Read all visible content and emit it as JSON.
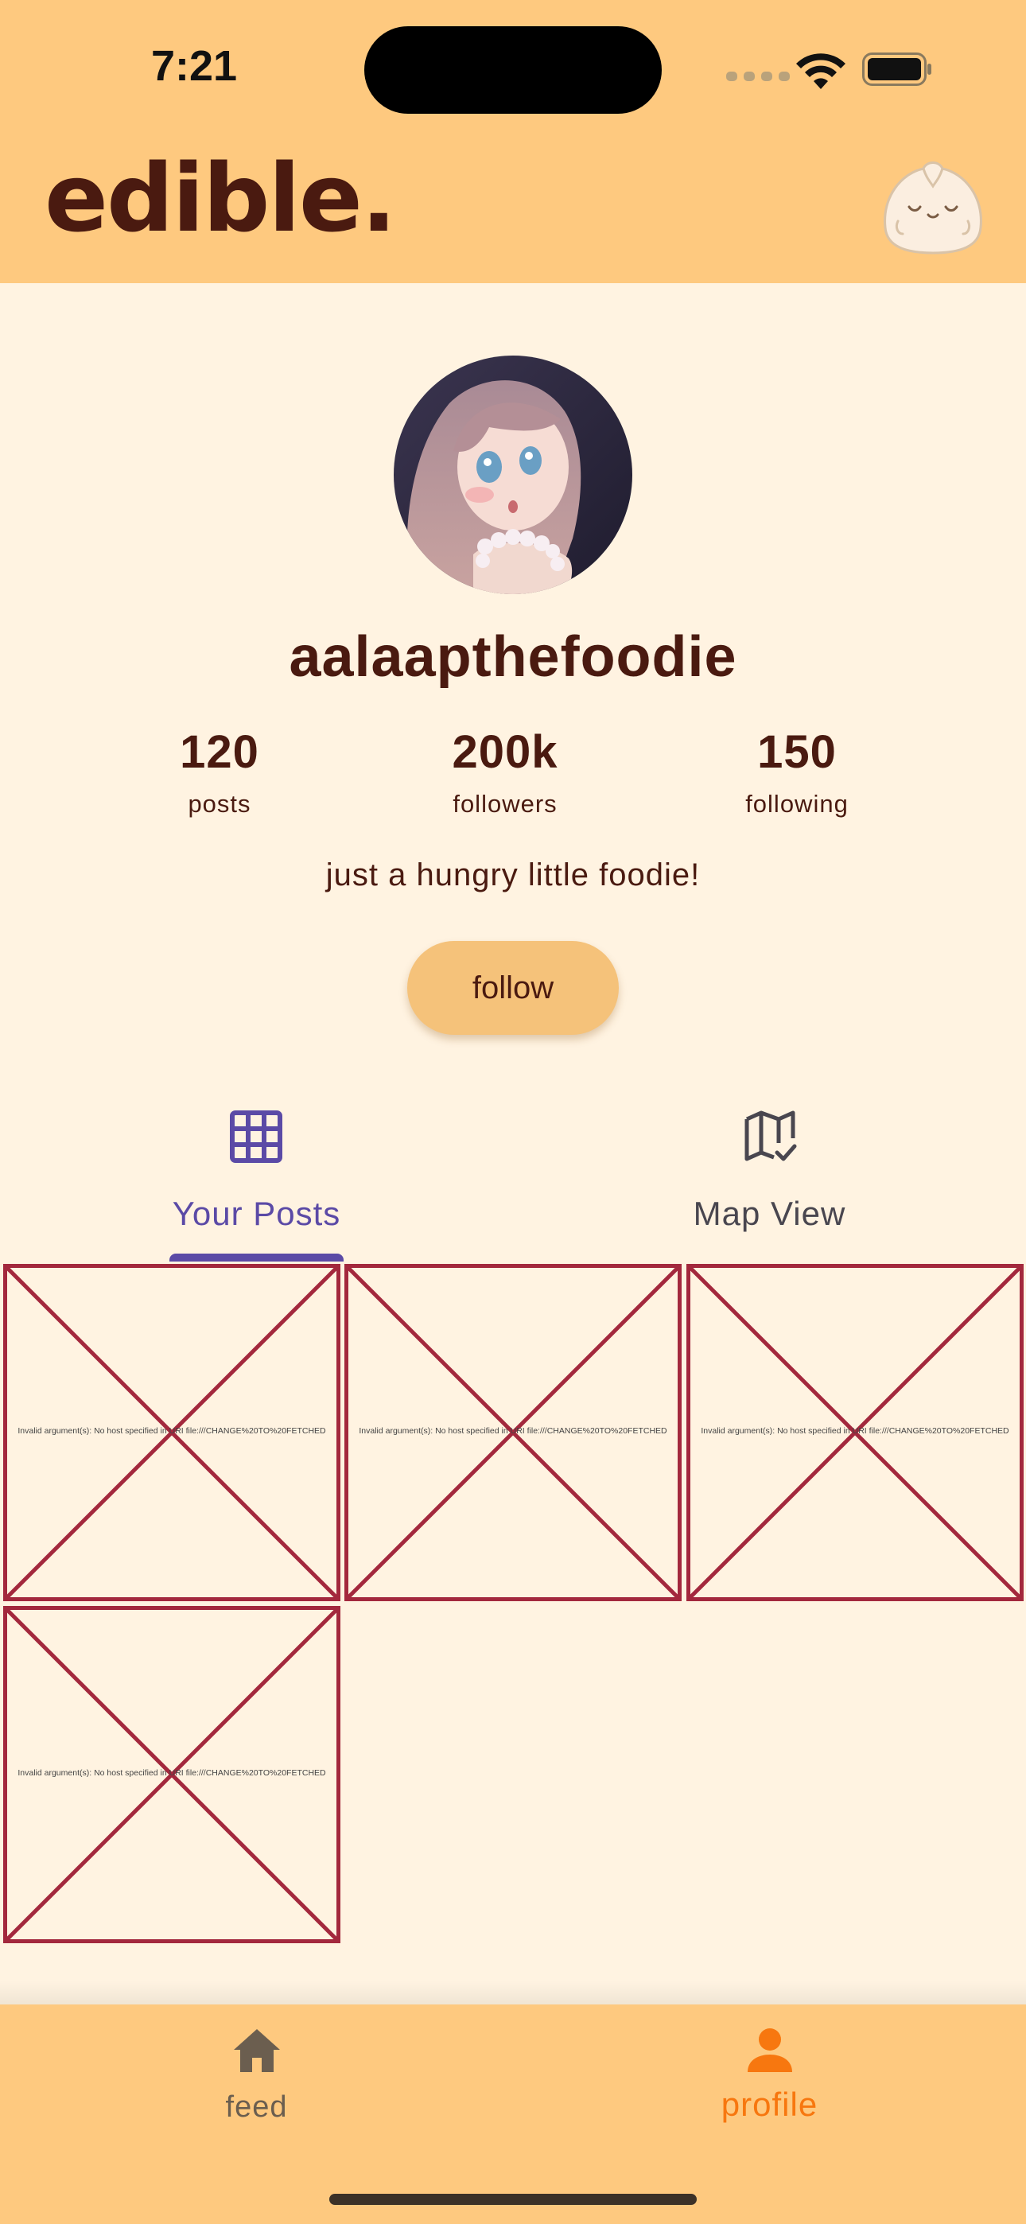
{
  "status_bar": {
    "time": "7:21"
  },
  "app_bar": {
    "brand": "edible."
  },
  "profile": {
    "username": "aalaapthefoodie",
    "stats": [
      {
        "value": "120",
        "label": "posts"
      },
      {
        "value": "200k",
        "label": "followers"
      },
      {
        "value": "150",
        "label": "following"
      }
    ],
    "bio": "just a hungry little foodie!",
    "follow_label": "follow"
  },
  "tabs": [
    {
      "label": "Your Posts",
      "icon": "grid-icon",
      "selected": true,
      "color": "#5b4aa6"
    },
    {
      "label": "Map View",
      "icon": "map-check-icon",
      "selected": false,
      "color": "#49464f"
    }
  ],
  "posts": [
    {
      "error": "Invalid argument(s): No host specified in URI file:///CHANGE%20TO%20FETCHED"
    },
    {
      "error": "Invalid argument(s): No host specified in URI file:///CHANGE%20TO%20FETCHED"
    },
    {
      "error": "Invalid argument(s): No host specified in URI file:///CHANGE%20TO%20FETCHED"
    },
    {
      "error": "Invalid argument(s): No host specified in URI file:///CHANGE%20TO%20FETCHED"
    }
  ],
  "bottom_nav": [
    {
      "label": "feed",
      "icon": "home-icon",
      "selected": false
    },
    {
      "label": "profile",
      "icon": "person-icon",
      "selected": true
    }
  ],
  "colors": {
    "app_bar": "#fec97f",
    "background": "#fff3e1",
    "text": "#4a1a10",
    "accent_tab": "#5b4aa6",
    "accent_nav": "#f7770f",
    "error_border": "#a3283d"
  }
}
